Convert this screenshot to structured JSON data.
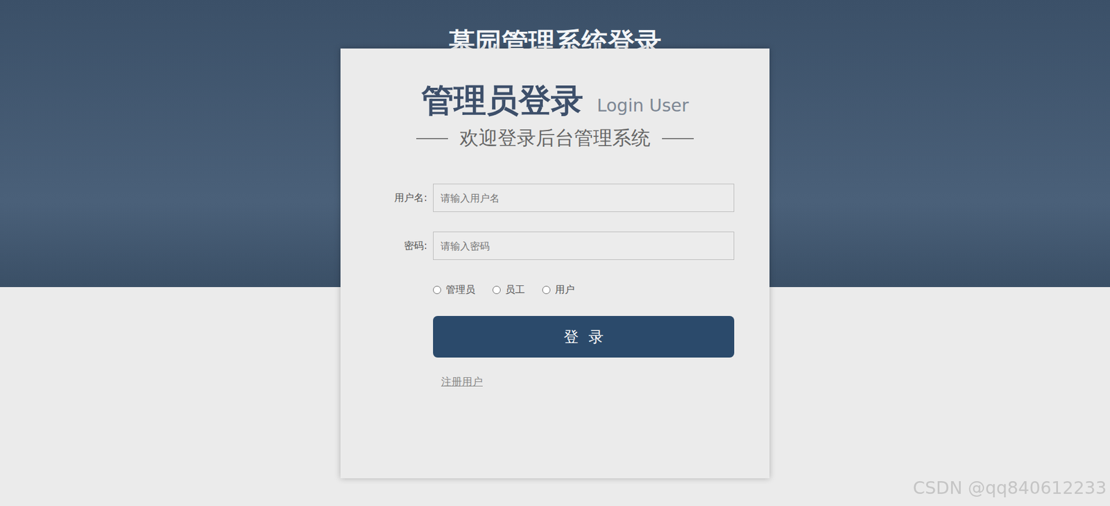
{
  "window": {
    "title": "墓园管理系统登录"
  },
  "card": {
    "heading": "管理员登录",
    "heading_en": "Login User",
    "subtitle": "欢迎登录后台管理系统"
  },
  "fields": [
    {
      "label": "用户名:",
      "placeholder": "请输入用户名",
      "kind": "text"
    },
    {
      "label": "密码:",
      "placeholder": "请输入密码",
      "kind": "password"
    }
  ],
  "roles": [
    {
      "label": "管理员",
      "selected": false
    },
    {
      "label": "员工",
      "selected": false
    },
    {
      "label": "用户",
      "selected": false
    }
  ],
  "button": "登  录",
  "link": "注册用户",
  "watermark": "CSDN @qq840612233"
}
